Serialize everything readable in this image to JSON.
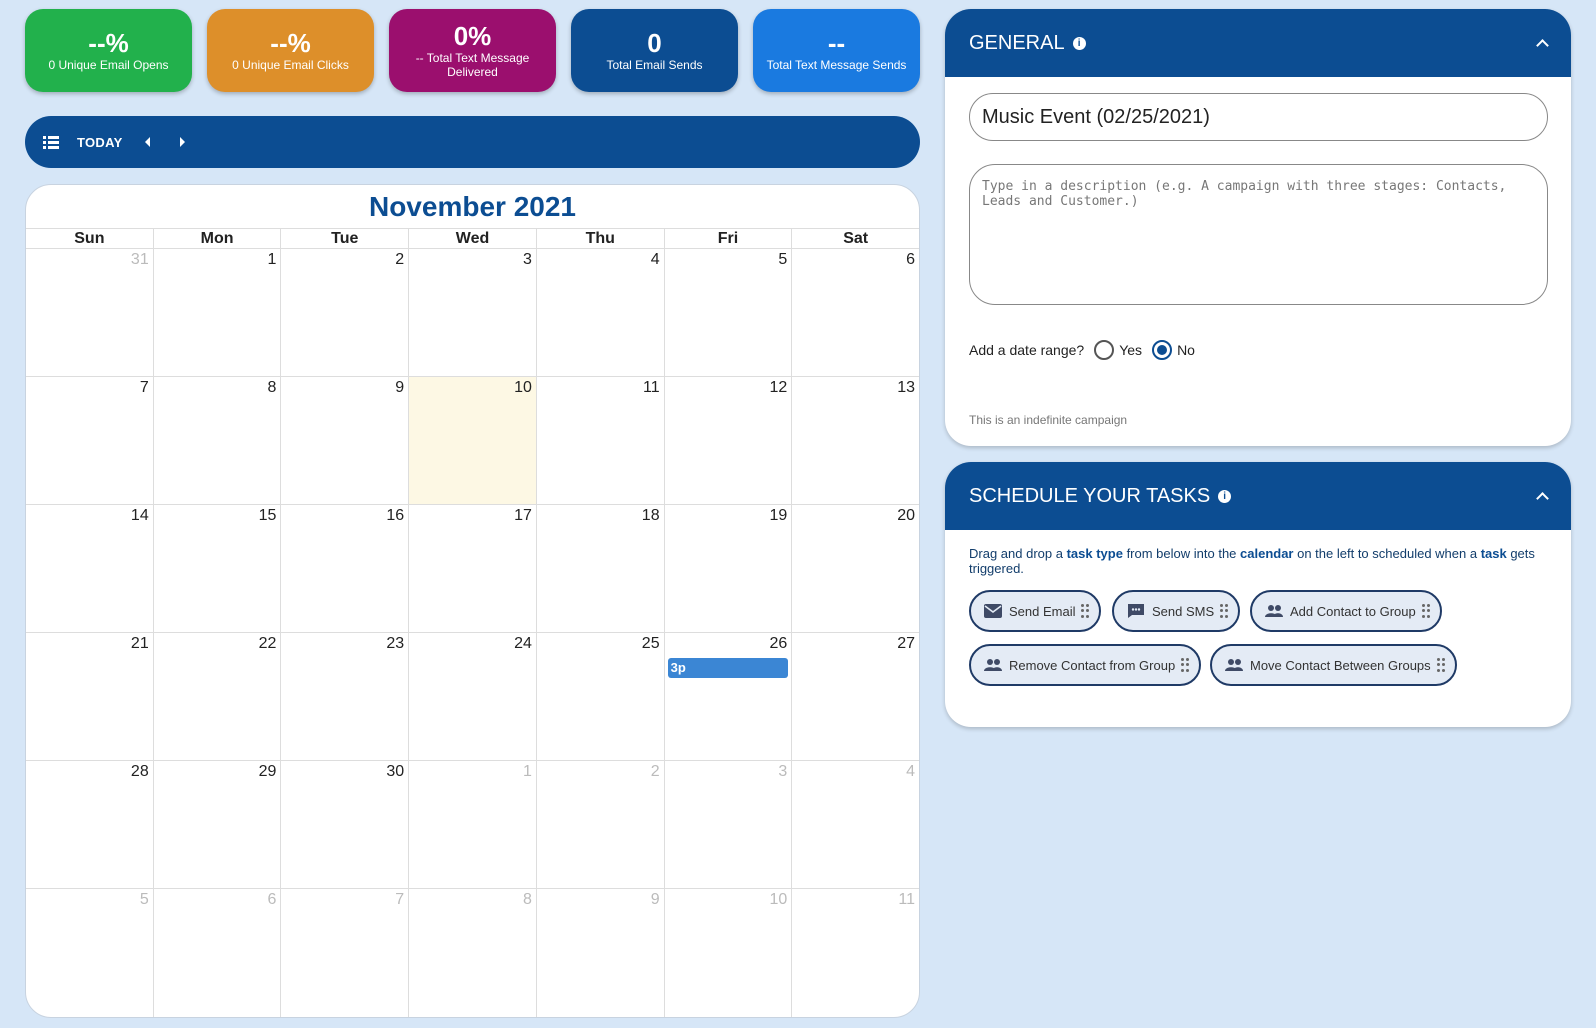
{
  "stats": [
    {
      "value": "--%",
      "label": "0 Unique Email Opens",
      "color": "#22b14c"
    },
    {
      "value": "--%",
      "label": "0 Unique Email Clicks",
      "color": "#dd8f2a"
    },
    {
      "value": "0%",
      "label": "-- Total Text Message Delivered",
      "color": "#9b0f6e"
    },
    {
      "value": "0",
      "label": "Total Email Sends",
      "color": "#0c4d92"
    },
    {
      "value": "--",
      "label": "Total Text Message Sends",
      "color": "#1a7ae0"
    }
  ],
  "toolbar": {
    "today_label": "TODAY"
  },
  "calendar": {
    "title": "November 2021",
    "days_of_week": [
      "Sun",
      "Mon",
      "Tue",
      "Wed",
      "Thu",
      "Fri",
      "Sat"
    ],
    "weeks": [
      [
        "31",
        "1",
        "2",
        "3",
        "4",
        "5",
        "6"
      ],
      [
        "7",
        "8",
        "9",
        "10",
        "11",
        "12",
        "13"
      ],
      [
        "14",
        "15",
        "16",
        "17",
        "18",
        "19",
        "20"
      ],
      [
        "21",
        "22",
        "23",
        "24",
        "25",
        "26",
        "27"
      ],
      [
        "28",
        "29",
        "30",
        "1",
        "2",
        "3",
        "4"
      ],
      [
        "5",
        "6",
        "7",
        "8",
        "9",
        "10",
        "11"
      ]
    ],
    "event_label": "3p"
  },
  "general": {
    "title": "GENERAL",
    "info_icon": "i",
    "name_value": "Music Event (02/25/2021)",
    "description_placeholder": "Type in a description (e.g. A campaign with three stages: Contacts, Leads and Customer.)",
    "date_range_label": "Add a date range?",
    "yes_label": "Yes",
    "no_label": "No",
    "hint": "This is an indefinite campaign"
  },
  "schedule": {
    "title": "SCHEDULE YOUR TASKS",
    "info_icon": "i",
    "desc_part1": "Drag and drop a ",
    "desc_bold1": "task type",
    "desc_part2": " from below into the ",
    "desc_bold2": "calendar",
    "desc_part3": " on the left to scheduled when a ",
    "desc_bold3": "task",
    "desc_part4": " gets triggered.",
    "chips": [
      {
        "label": "Send Email",
        "icon": "email-icon"
      },
      {
        "label": "Send SMS",
        "icon": "sms-icon"
      },
      {
        "label": "Add Contact to Group",
        "icon": "group-icon"
      },
      {
        "label": "Remove Contact from Group",
        "icon": "group-icon"
      },
      {
        "label": "Move Contact Between Groups",
        "icon": "group-icon"
      }
    ]
  }
}
